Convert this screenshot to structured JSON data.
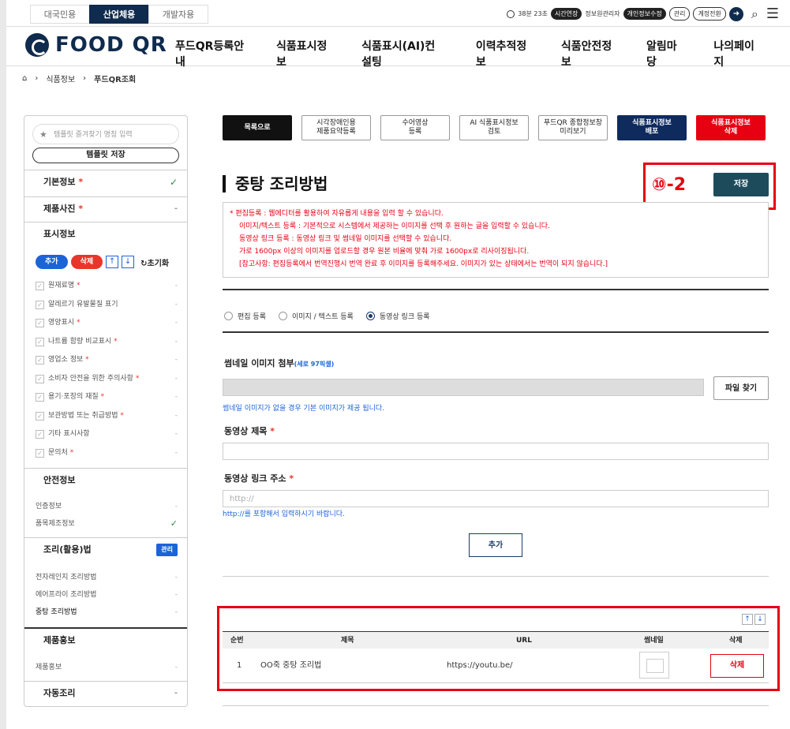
{
  "utilbar": {
    "sites": [
      {
        "label": "대국민용",
        "active": false
      },
      {
        "label": "산업체용",
        "active": true
      },
      {
        "label": "개발자용",
        "active": false
      }
    ],
    "timer": "38분 23초",
    "extend": "시간연장",
    "manager": "정보원관리자",
    "privacy": "개인정보수정",
    "admin": "관리",
    "switch": "계정전환"
  },
  "header": {
    "logo": "FOOD QR",
    "gnb": [
      "푸드QR등록안내",
      "식품표시정보",
      "식품표시(AI)컨설팅",
      "이력추적정보",
      "식품안전정보",
      "알림마당",
      "나의페이지"
    ]
  },
  "breadcrumb": {
    "items": [
      "식품정보",
      "푸드QR조회"
    ]
  },
  "sidebar": {
    "template_placeholder": "템플릿 즐겨찾기 명칭 입력",
    "template_save": "템플릿 저장",
    "sections": {
      "basic": "기본정보",
      "photo": "제품사진",
      "display": "표시정보",
      "safety": "안전정보",
      "cooking": "조리(활용)법",
      "promo": "제품홍보",
      "auto": "자동조리"
    },
    "toolbar": {
      "add": "추가",
      "delete": "삭제",
      "up": "↑",
      "down": "↓",
      "reset": "초기화"
    },
    "display_items": [
      {
        "label": "원재료명",
        "req": "*"
      },
      {
        "label": "알레르기 유발물질 표기",
        "req": ""
      },
      {
        "label": "영양표시",
        "req": "*"
      },
      {
        "label": "나트륨 함량 비교표시",
        "req": "*"
      },
      {
        "label": "영업소 정보",
        "req": "*"
      },
      {
        "label": "소비자 안전을 위한 주의사항",
        "req": "*"
      },
      {
        "label": "용기·포장의 재질",
        "req": "*"
      },
      {
        "label": "보관방법 또는 취급방법",
        "req": "*"
      },
      {
        "label": "기타 표시사항",
        "req": ""
      },
      {
        "label": "문의처",
        "req": "*"
      }
    ],
    "safety_items": [
      "인증정보",
      "품목제조정보"
    ],
    "manage_badge": "관리",
    "cooking_items": [
      "전자레인지 조리방법",
      "에어프라이 조리방법",
      "중탕 조리방법"
    ],
    "promo_items": [
      "제품홍보"
    ],
    "required_mark": "*"
  },
  "actions": [
    {
      "label": "목록으로",
      "style": "black"
    },
    {
      "label": "시각장애인용\n제품요약등록",
      "style": "plain"
    },
    {
      "label": "수어영상\n등록",
      "style": "plain"
    },
    {
      "label": "AI 식품표시정보\n검토",
      "style": "plain"
    },
    {
      "label": "푸드QR 종합정보창\n미리보기",
      "style": "plain"
    },
    {
      "label": "식품표시정보\n배포",
      "style": "navy"
    },
    {
      "label": "식품표시정보\n삭제",
      "style": "red"
    }
  ],
  "main": {
    "title": "중탕 조리방법",
    "step_label": "⑩-2",
    "save": "저장",
    "notice": [
      "* 편집등록 : 웹에디터를 활용하여 자유롭게 내용을 입력 할 수 있습니다.",
      "이미지/텍스트 등록 : 기본적으로 시스템에서 제공하는 이미지를 선택 후 원하는 글을 입력할 수 있습니다.",
      "동영상 링크 등록 : 동영상 링크 및 썸네일 이미지를 선택할 수 있습니다.",
      "가로 1600px 이상의 이미지를 업로드할 경우 원본 비율에 맞춰 가로 1600px로 리사이징됩니다.",
      "[참고사항: 편집등록에서 번역진행시 번역 완료 후 이미지를 등록해주세요. 이미지가 있는 상태에서는 번역이 되지 않습니다.]"
    ],
    "radios": [
      {
        "label": "편집 등록",
        "checked": false
      },
      {
        "label": "이미지 / 텍스트 등록",
        "checked": false
      },
      {
        "label": "동영상 링크 등록",
        "checked": true
      }
    ],
    "thumb_label": "썸네일 이미지 첨부",
    "thumb_note": "(세로 97픽셀)",
    "file_button": "파일 찾기",
    "thumb_help": "썸네일 이미지가 없을 경우 기본 이미지가 제공 됩니다.",
    "video_title_label": "동영상 제목",
    "video_link_label": "동영상 링크 주소",
    "link_placeholder": "http://",
    "link_help": "http://를 포함해서 입력하시기 바랍니다.",
    "add_button": "추가"
  },
  "table": {
    "headers": [
      "순번",
      "제목",
      "URL",
      "썸네일",
      "삭제"
    ],
    "rows": [
      {
        "no": "1",
        "title": "OO죽 중탕 조리법",
        "url": "https://youtu.be/",
        "delete": "삭제"
      }
    ]
  }
}
